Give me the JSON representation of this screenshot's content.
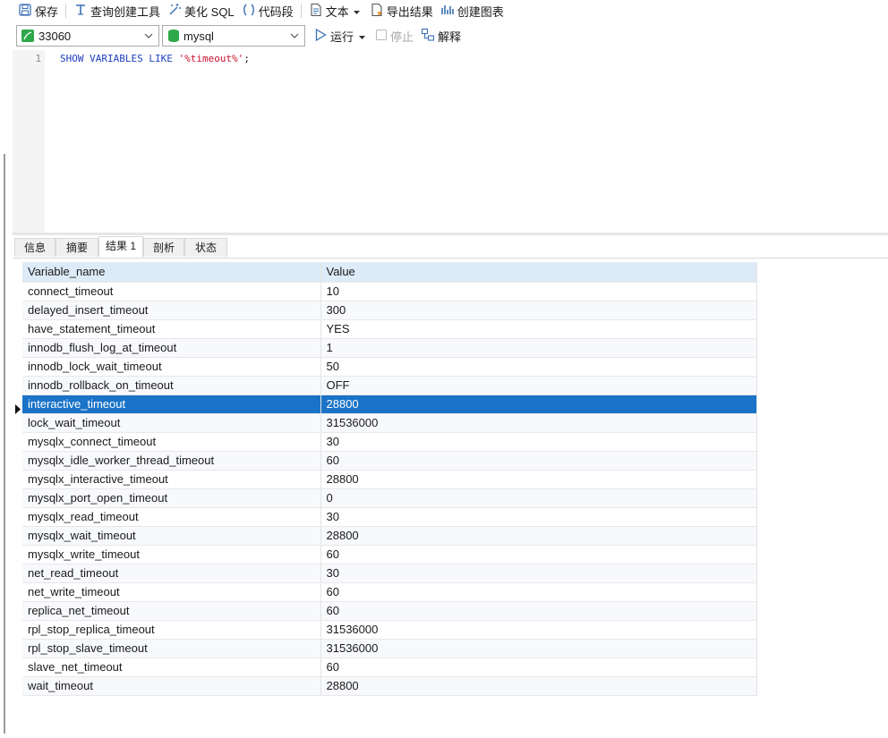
{
  "toolbar": {
    "save": "保存",
    "query_builder": "查询创建工具",
    "beautify": "美化 SQL",
    "snippet": "代码段",
    "text": "文本",
    "export": "导出结果",
    "chart": "创建图表"
  },
  "toolbar2": {
    "connection": "33060",
    "database": "mysql",
    "run": "运行",
    "stop": "停止",
    "explain": "解释"
  },
  "editor": {
    "line_number": "1",
    "code_kw": "SHOW VARIABLES LIKE ",
    "code_str": "'%timeout%'",
    "code_end": ";"
  },
  "tabs": [
    "信息",
    "摘要",
    "结果 1",
    "剖析",
    "状态"
  ],
  "grid": {
    "headers": [
      "Variable_name",
      "Value"
    ],
    "selected_index": 6,
    "rows": [
      [
        "connect_timeout",
        "10"
      ],
      [
        "delayed_insert_timeout",
        "300"
      ],
      [
        "have_statement_timeout",
        "YES"
      ],
      [
        "innodb_flush_log_at_timeout",
        "1"
      ],
      [
        "innodb_lock_wait_timeout",
        "50"
      ],
      [
        "innodb_rollback_on_timeout",
        "OFF"
      ],
      [
        "interactive_timeout",
        "28800"
      ],
      [
        "lock_wait_timeout",
        "31536000"
      ],
      [
        "mysqlx_connect_timeout",
        "30"
      ],
      [
        "mysqlx_idle_worker_thread_timeout",
        "60"
      ],
      [
        "mysqlx_interactive_timeout",
        "28800"
      ],
      [
        "mysqlx_port_open_timeout",
        "0"
      ],
      [
        "mysqlx_read_timeout",
        "30"
      ],
      [
        "mysqlx_wait_timeout",
        "28800"
      ],
      [
        "mysqlx_write_timeout",
        "60"
      ],
      [
        "net_read_timeout",
        "30"
      ],
      [
        "net_write_timeout",
        "60"
      ],
      [
        "replica_net_timeout",
        "60"
      ],
      [
        "rpl_stop_replica_timeout",
        "31536000"
      ],
      [
        "rpl_stop_slave_timeout",
        "31536000"
      ],
      [
        "slave_net_timeout",
        "60"
      ],
      [
        "wait_timeout",
        "28800"
      ]
    ]
  },
  "colors": {
    "accent": "#1a73c7",
    "header_bg": "#ddeaf7",
    "keyword": "#1f3fbf",
    "string": "#c8102e"
  },
  "icons": [
    "save-icon",
    "query-builder-icon",
    "beautify-icon",
    "snippet-icon",
    "text-icon",
    "export-icon",
    "chart-icon",
    "connection-icon",
    "database-icon",
    "run-icon",
    "stop-icon",
    "explain-icon"
  ]
}
